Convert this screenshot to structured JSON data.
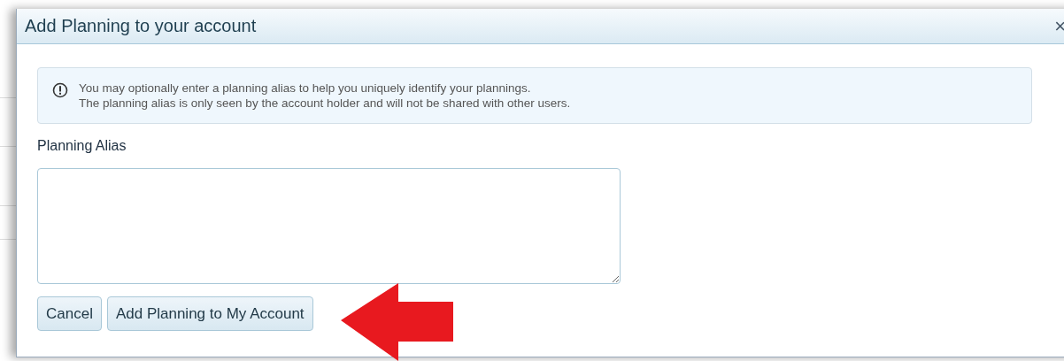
{
  "dialog": {
    "title": "Add Planning to your account",
    "close": "×"
  },
  "info": {
    "lines": [
      "You may optionally enter a planning alias to help you uniquely identify your plannings.",
      "The planning alias is only seen by the account holder and will not be shared with other users."
    ]
  },
  "field": {
    "label": "Planning Alias"
  },
  "buttons": [
    {
      "label": "Cancel"
    },
    {
      "label": "Add Planning to My Account"
    }
  ]
}
